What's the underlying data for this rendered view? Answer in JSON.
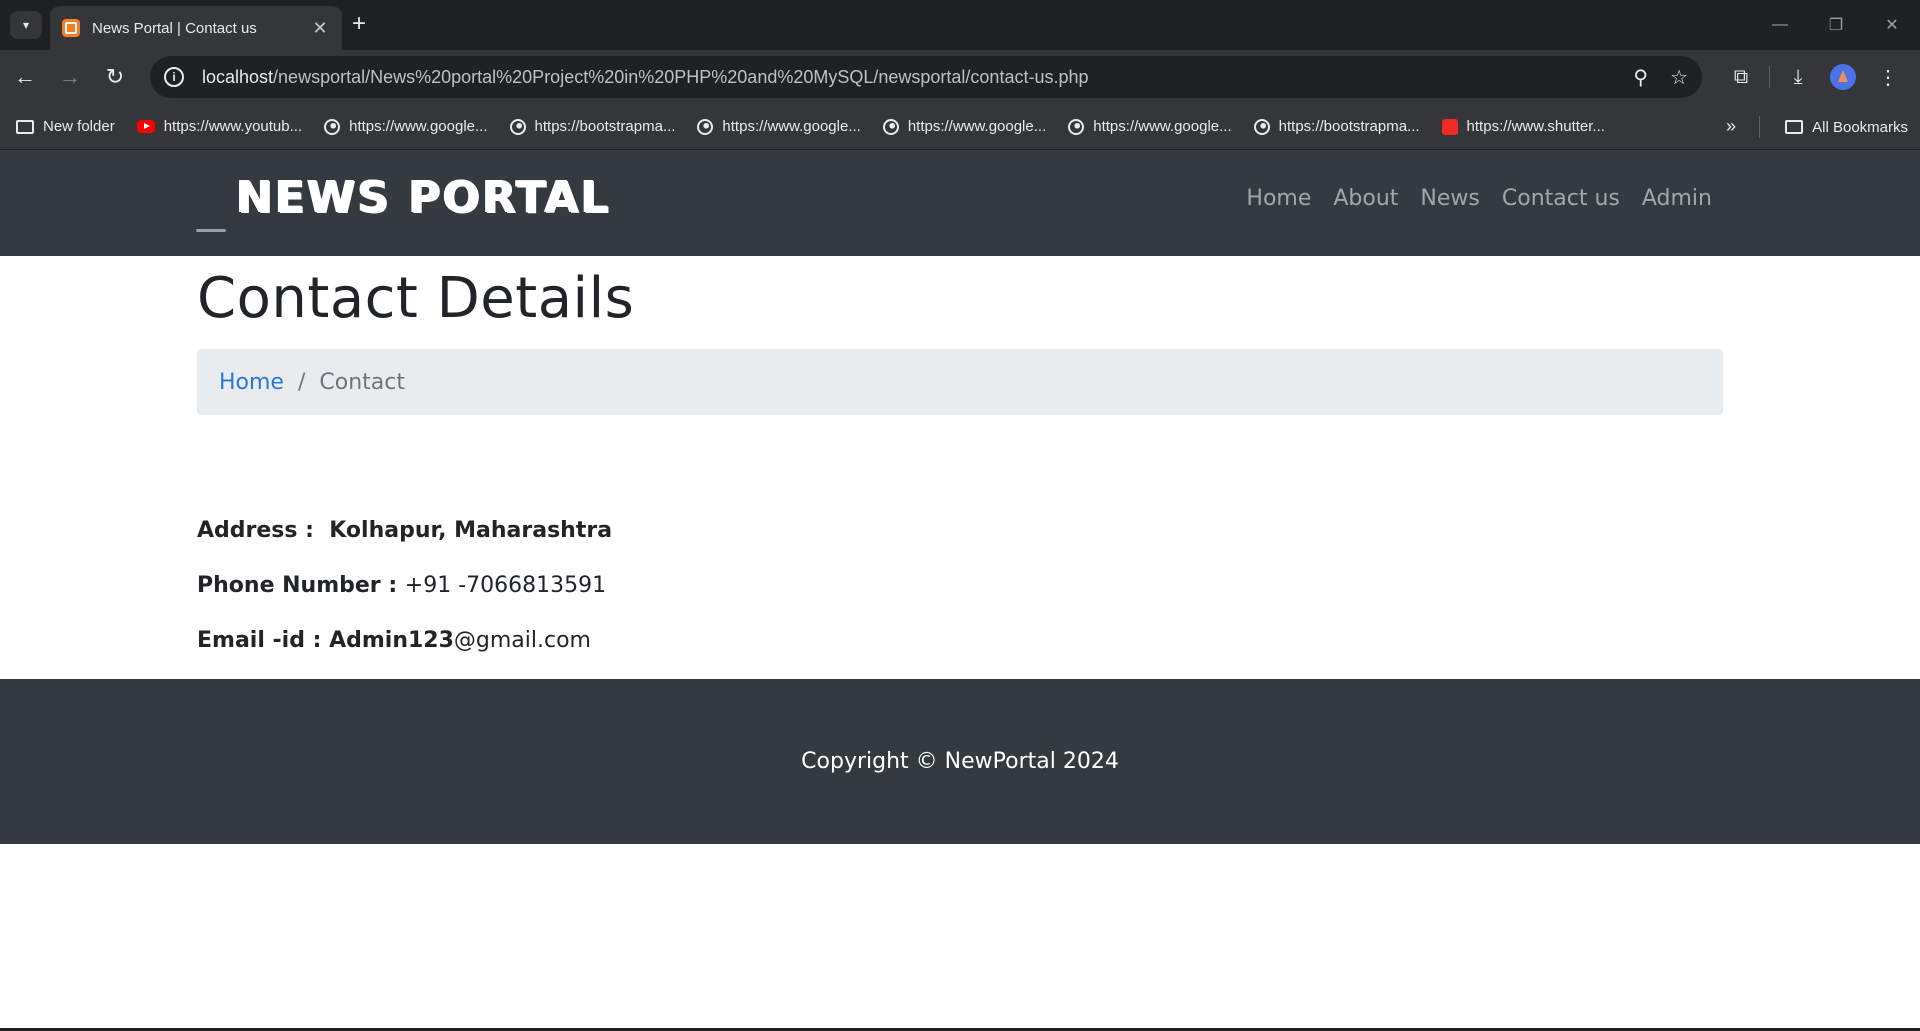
{
  "browser": {
    "tab_title": "News Portal | Contact us",
    "url_host": "localhost",
    "url_path": "/newsportal/News%20portal%20Project%20in%20PHP%20and%20MySQL/newsportal/contact-us.php",
    "bookmarks": [
      {
        "label": "New folder",
        "icon": "folder-icon"
      },
      {
        "label": "https://www.youtub...",
        "icon": "youtube-icon"
      },
      {
        "label": "https://www.google...",
        "icon": "globe-icon"
      },
      {
        "label": "https://bootstrapma...",
        "icon": "globe-icon"
      },
      {
        "label": "https://www.google...",
        "icon": "globe-icon"
      },
      {
        "label": "https://www.google...",
        "icon": "globe-icon"
      },
      {
        "label": "https://www.google...",
        "icon": "globe-icon"
      },
      {
        "label": "https://bootstrapma...",
        "icon": "globe-icon"
      },
      {
        "label": "https://www.shutter...",
        "icon": "shutterstock-icon"
      }
    ],
    "all_bookmarks": "All Bookmarks"
  },
  "site": {
    "brand": "NEWS PORTAL",
    "nav": [
      "Home",
      "About",
      "News",
      "Contact us",
      "Admin"
    ],
    "page_title": "Contact Details",
    "breadcrumb": {
      "home": "Home",
      "separator": "/",
      "current": "Contact"
    },
    "address_label": "Address :  ",
    "address_value": "Kolhapur, Maharashtra",
    "phone_label": "Phone Number : ",
    "phone_value": "+91 -7066813591",
    "email_label": "Email -id : ",
    "email_bold": "Admin123",
    "email_rest": "@gmail.com",
    "copyright": "Copyright © NewPortal 2024"
  },
  "colors": {
    "navbar_bg": "#343a40",
    "link": "#2a78d6",
    "breadcrumb_bg": "#e9ecef"
  }
}
